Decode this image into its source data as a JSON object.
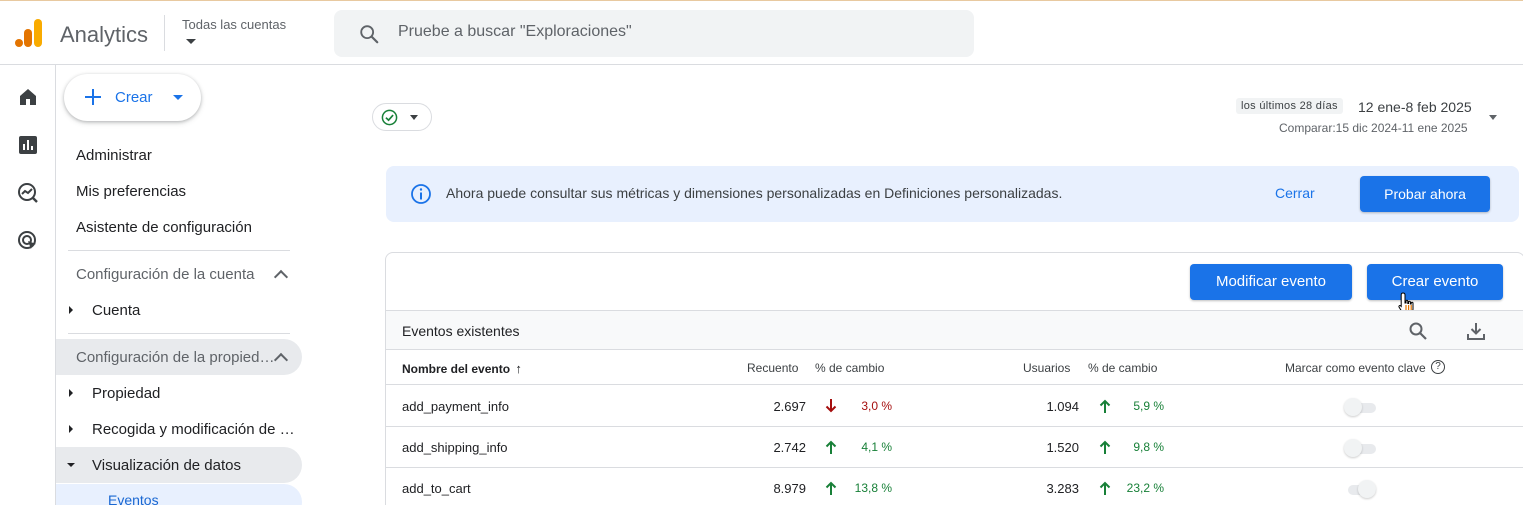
{
  "header": {
    "app_title": "Analytics",
    "account_label": "Todas las cuentas",
    "search_placeholder": "Pruebe a buscar \"Exploraciones\""
  },
  "rail": {
    "icons": [
      "home-icon",
      "reports-icon",
      "explore-icon",
      "advertising-icon"
    ]
  },
  "nav": {
    "create_label": "Crear",
    "items": [
      "Administrar",
      "Mis preferencias",
      "Asistente de configuración"
    ],
    "account_section": "Configuración de la cuenta",
    "account_children": [
      "Cuenta"
    ],
    "property_section": "Configuración de la propied…",
    "property_children": [
      "Propiedad",
      "Recogida y modificación de …",
      "Visualización de datos"
    ],
    "active_subitem": "Eventos"
  },
  "date": {
    "period_chip": "los últimos 28 días",
    "range": "12 ene-8 feb 2025",
    "compare": "Comparar:15 dic 2024-11 ene 2025"
  },
  "banner": {
    "text": "Ahora puede consultar sus métricas y dimensiones personalizadas en Definiciones personalizadas.",
    "close_label": "Cerrar",
    "try_label": "Probar ahora"
  },
  "card": {
    "modify_label": "Modificar evento",
    "create_label": "Crear evento",
    "subhead": "Eventos existentes"
  },
  "table": {
    "columns": {
      "name": "Nombre del evento",
      "sort_arrow": "↑",
      "count": "Recuento",
      "count_change": "% de cambio",
      "users": "Usuarios",
      "users_change": "% de cambio",
      "key_event": "Marcar como evento clave",
      "help": "?"
    },
    "rows": [
      {
        "name": "add_payment_info",
        "count": "2.697",
        "count_change": "3,0 %",
        "count_dir": "down",
        "users": "1.094",
        "users_change": "5,9 %",
        "users_dir": "up",
        "key_event": false
      },
      {
        "name": "add_shipping_info",
        "count": "2.742",
        "count_change": "4,1 %",
        "count_dir": "up",
        "users": "1.520",
        "users_change": "9,8 %",
        "users_dir": "up",
        "key_event": false
      },
      {
        "name": "add_to_cart",
        "count": "8.979",
        "count_change": "13,8 %",
        "count_dir": "up",
        "users": "3.283",
        "users_change": "23,2 %",
        "users_dir": "up",
        "key_event": false
      }
    ]
  },
  "colors": {
    "primary": "#1a73e8",
    "up": "#188038",
    "down": "#a50e0e",
    "logo_orange": "#f9ab00",
    "logo_dark_orange": "#e37400"
  }
}
